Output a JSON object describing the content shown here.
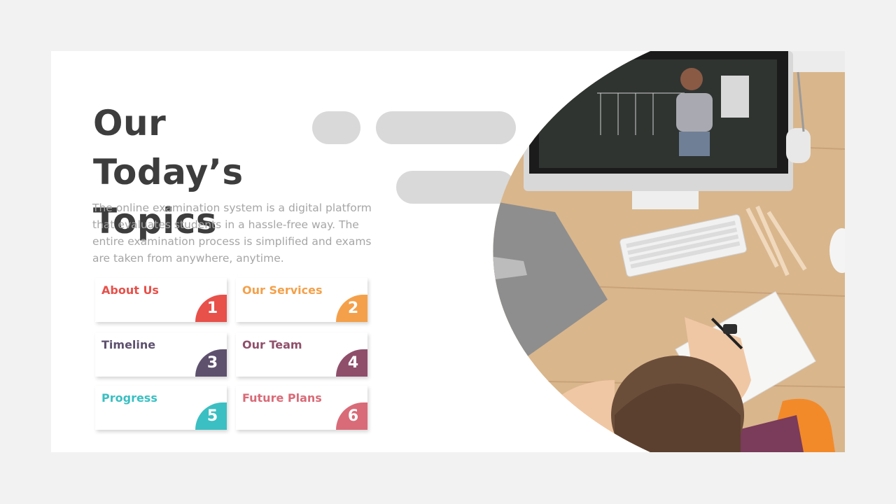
{
  "title": "Our Today’s Topics",
  "description": "The online examination system is a digital platform that evaluates students in a hassle-free way. The entire examination process is simplified and exams are taken from anywhere, anytime.",
  "topics": [
    {
      "label": "About Us",
      "number": "1",
      "color": "#e8504a"
    },
    {
      "label": "Our Services",
      "number": "2",
      "color": "#f4a04a"
    },
    {
      "label": "Timeline",
      "number": "3",
      "color": "#5e516e"
    },
    {
      "label": "Our Team",
      "number": "4",
      "color": "#8f4f6a"
    },
    {
      "label": "Progress",
      "number": "5",
      "color": "#3bbfc2"
    },
    {
      "label": "Future Plans",
      "number": "6",
      "color": "#d96b78"
    }
  ],
  "colors": {
    "background": "#f2f2f2",
    "slide": "#ffffff",
    "title": "#3d3d3d",
    "text": "#a6a6a6",
    "pill": "#d9d9d9"
  },
  "image": {
    "subject": "online-exam-photo-icon"
  }
}
